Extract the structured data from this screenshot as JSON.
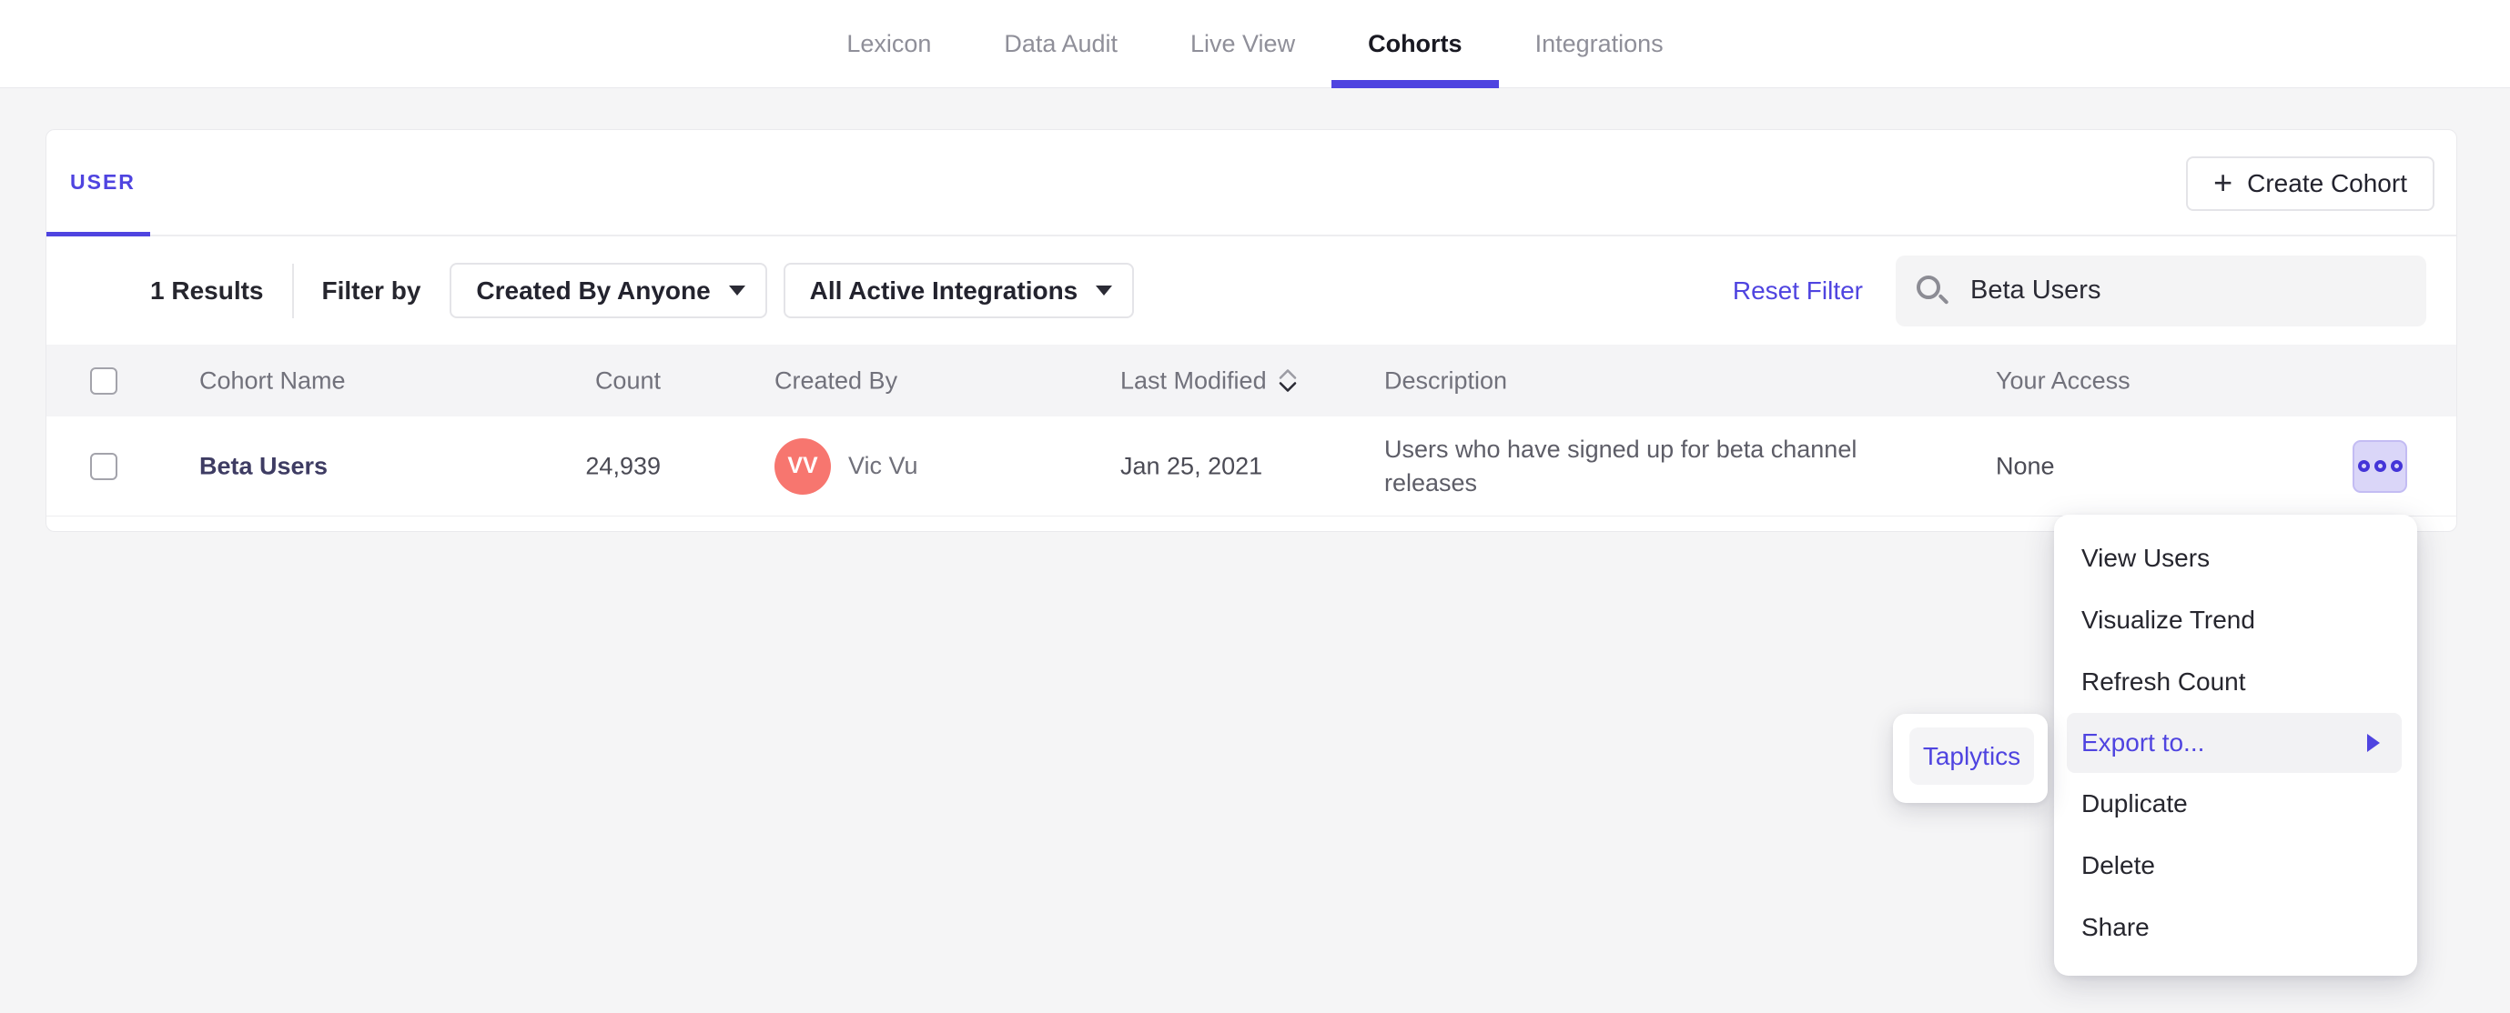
{
  "nav": {
    "tabs": [
      {
        "label": "Lexicon",
        "active": false
      },
      {
        "label": "Data Audit",
        "active": false
      },
      {
        "label": "Live View",
        "active": false
      },
      {
        "label": "Cohorts",
        "active": true
      },
      {
        "label": "Integrations",
        "active": false
      }
    ]
  },
  "panel": {
    "tab_label": "USER",
    "create_button": {
      "plus": "+",
      "label": "Create Cohort"
    },
    "filters": {
      "results": "1 Results",
      "filter_by": "Filter by",
      "created_by_dropdown": "Created By Anyone",
      "integrations_dropdown": "All Active Integrations",
      "reset": "Reset Filter",
      "search_value": "Beta Users"
    },
    "table": {
      "headers": {
        "name": "Cohort Name",
        "count": "Count",
        "created_by": "Created By",
        "last_modified": "Last Modified",
        "description": "Description",
        "access": "Your Access"
      },
      "rows": [
        {
          "name": "Beta Users",
          "count": "24,939",
          "avatar_initials": "VV",
          "creator": "Vic Vu",
          "last_modified": "Jan 25, 2021",
          "description": "Users who have signed up for beta channel releases",
          "access": "None"
        }
      ]
    }
  },
  "context_menu": {
    "items": [
      {
        "label": "View Users"
      },
      {
        "label": "Visualize Trend"
      },
      {
        "label": "Refresh Count"
      },
      {
        "label": "Export to...",
        "highlighted": true,
        "has_submenu": true
      },
      {
        "label": "Duplicate"
      },
      {
        "label": "Delete"
      },
      {
        "label": "Share"
      }
    ],
    "submenu": {
      "items": [
        {
          "label": "Taplytics"
        }
      ]
    }
  },
  "colors": {
    "accent_purple": "#4F44E0",
    "page_background": "#F5F5F6",
    "table_header_background": "#F4F4F6",
    "avatar_coral": "#F7766F",
    "more_button_lavender": "#DAD6F8",
    "menu_highlight_gray": "#F2F2F4",
    "cohort_link_navy": "#3E3C63"
  }
}
